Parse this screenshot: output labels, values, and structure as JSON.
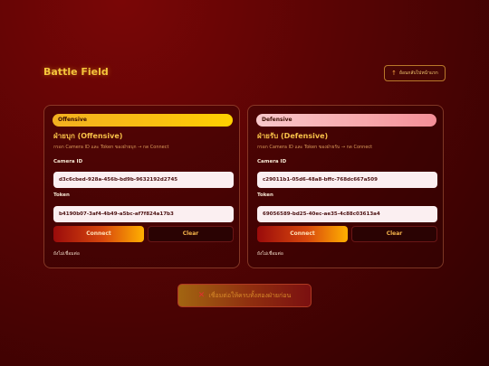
{
  "header": {
    "title": "Battle Field",
    "back_label": "ย้อนกลับไปหน้าแรก",
    "back_icon": "arrow-up-icon"
  },
  "panels": [
    {
      "badge": "Offensive",
      "heading": "ฝ่ายบุก (Offensive)",
      "hint": "กรอก Camera ID และ Token ของฝ่ายบุก → กด Connect",
      "camera_label": "Camera ID",
      "camera_value": "d3c6cbed-928a-456b-bd9b-9632192d2745",
      "token_label": "Token",
      "token_value": "b4190b07-3af4-4b49-a5bc-af7f824a17b3",
      "connect_label": "Connect",
      "clear_label": "Clear",
      "status": "ยังไม่เชื่อมต่อ"
    },
    {
      "badge": "Defensive",
      "heading": "ฝ่ายรับ (Defensive)",
      "hint": "กรอก Camera ID และ Token ของฝ่ายรับ → กด Connect",
      "camera_label": "Camera ID",
      "camera_value": "c29011b1-05d6-48a8-bffc-768dc667a509",
      "token_label": "Token",
      "token_value": "69056589-bd25-40ec-ae35-4c88c03613a4",
      "connect_label": "Connect",
      "clear_label": "Clear",
      "status": "ยังไม่เชื่อมต่อ"
    }
  ],
  "start": {
    "icon": "x-icon",
    "label": "เชื่อมต่อให้ครบทั้งสองฝ่ายก่อน"
  },
  "colors": {
    "accent_gold": "#f5c53b",
    "offensive": "#fac010",
    "defensive": "#f7a8ac",
    "background": "#560404"
  }
}
